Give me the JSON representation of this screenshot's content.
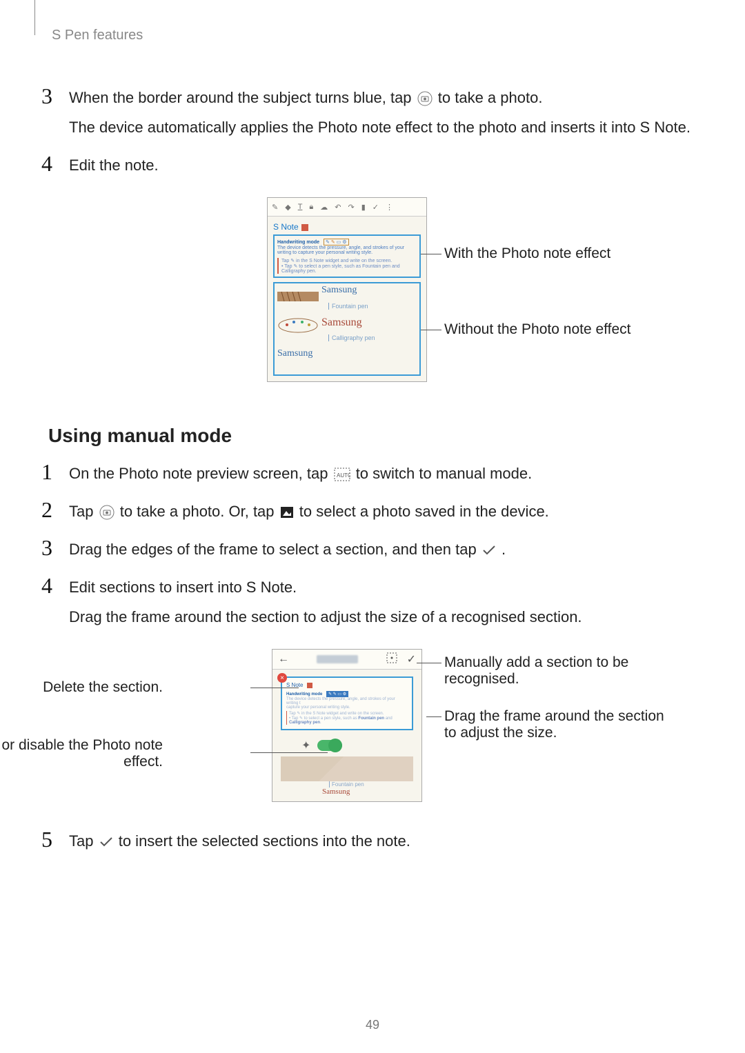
{
  "header": {
    "breadcrumb": "S Pen features"
  },
  "page_number": "49",
  "steps_a": [
    {
      "num": "3",
      "line1_before": "When the border around the subject turns blue, tap ",
      "line1_after": " to take a photo.",
      "line2": "The device automatically applies the Photo note effect to the photo and inserts it into S Note."
    },
    {
      "num": "4",
      "line1_before": "Edit the note.",
      "line1_after": "",
      "line2": ""
    }
  ],
  "figure1": {
    "callout_top_right": "With the Photo note effect",
    "callout_mid_right": "Without the Photo note effect",
    "snote_title": "S Note",
    "hw_mode": "Handwriting mode",
    "desc": "The device detects the pressure, angle, and strokes of your writing to capture your personal writing style.",
    "instr1": "Tap  ✎  in the S Note widget and write on the screen.",
    "instr2": "• Tap  ✎  to select a pen style, such as Fountain pen and Calligraphy pen.",
    "fountain_label": "Fountain pen",
    "calli_label": "Calligraphy pen"
  },
  "section_heading": "Using manual mode",
  "steps_b": [
    {
      "num": "1",
      "segments": [
        "On the Photo note preview screen, tap ",
        " to switch to manual mode."
      ]
    },
    {
      "num": "2",
      "segments": [
        "Tap ",
        " to take a photo. Or, tap ",
        " to select a photo saved in the device."
      ]
    },
    {
      "num": "3",
      "segments": [
        "Drag the edges of the frame to select a section, and then tap ",
        "."
      ]
    },
    {
      "num": "4",
      "line1": "Edit sections to insert into S Note.",
      "line2": "Drag the frame around the section to adjust the size of a recognised section."
    },
    {
      "num": "5",
      "segments": [
        "Tap ",
        " to insert the selected sections into the note."
      ]
    }
  ],
  "figure2": {
    "callout_delete": "Delete the section.",
    "callout_enable": "Enable or disable the Photo note effect.",
    "callout_manual_add": "Manually add a section to be recognised.",
    "callout_drag": "Drag the frame around the section to adjust the size.",
    "snote_title": "S Note",
    "hw_mode": "Handwriting mode",
    "fountain_label": "Fountain pen"
  },
  "icons": {
    "camera": "camera-icon",
    "auto_manual": "auto-manual-icon",
    "gallery": "gallery-icon",
    "check": "check-icon"
  }
}
